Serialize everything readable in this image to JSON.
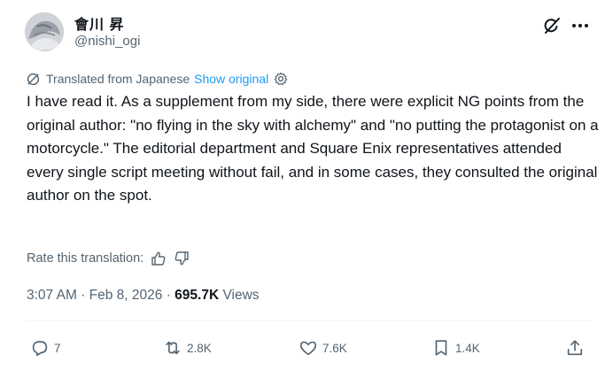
{
  "author": {
    "display_name": "會川 昇",
    "handle": "@nishi_ogi"
  },
  "translation": {
    "label": "Translated from Japanese",
    "show_original": "Show original"
  },
  "tweet": {
    "text": "I have read it. As a supplement from my side, there were explicit NG points from the original author: \"no flying in the sky with alchemy\" and \"no putting the protagonist on a motorcycle.\" The editorial department and Square Enix representatives attended every single script meeting without fail, and in some cases, they consulted the original author on the spot."
  },
  "rate": {
    "label": "Rate this translation:"
  },
  "meta": {
    "time": "3:07 AM",
    "sep1": " · ",
    "date": "Feb 8, 2026",
    "sep2": " · ",
    "views_count": "695.7K",
    "views_label": " Views"
  },
  "actions": {
    "replies": "7",
    "reposts": "2.8K",
    "likes": "7.6K",
    "bookmarks": "1.4K"
  },
  "icons": {
    "header": [
      "grok-icon",
      "more-icon"
    ],
    "translation": [
      "globe-icon",
      "gear-icon"
    ],
    "rate": [
      "thumbs-up-icon",
      "thumbs-down-icon"
    ],
    "actions": [
      "reply-icon",
      "repost-icon",
      "like-icon",
      "bookmark-icon",
      "share-icon"
    ]
  },
  "colors": {
    "text": "#0f1419",
    "secondary": "#536471",
    "link": "#1d9bf0"
  }
}
